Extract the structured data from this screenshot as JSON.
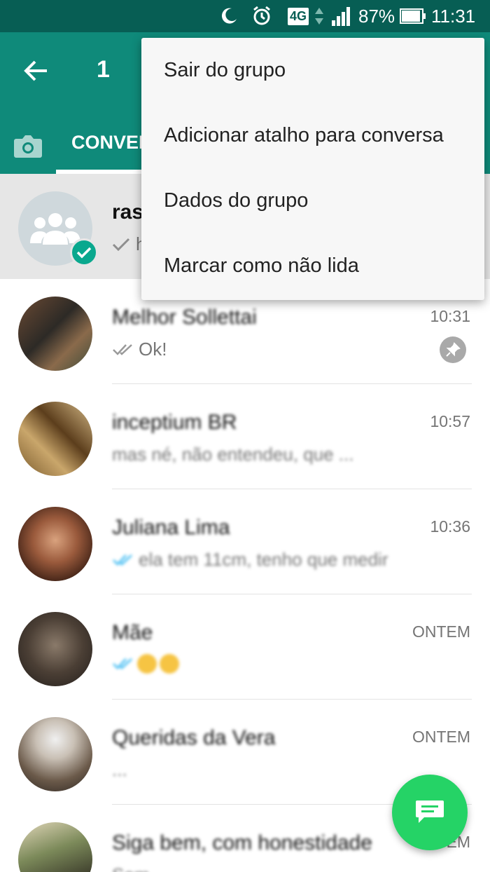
{
  "status_bar": {
    "battery": "87%",
    "time": "11:31",
    "network": "4G"
  },
  "app_bar": {
    "selected_count": "1"
  },
  "tabs": {
    "chats_label": "CONVERSAS"
  },
  "menu": {
    "items": [
      "Sair do grupo",
      "Adicionar atalho para conversa",
      "Dados do grupo",
      "Marcar como não lida"
    ]
  },
  "chats": [
    {
      "name": "ras",
      "preview": "h",
      "time": ""
    },
    {
      "name": "Melhor Sollettai",
      "preview": "Ok!",
      "time": "10:31"
    },
    {
      "name": "inceptium BR",
      "preview": "mas né, não entendeu, que ...",
      "time": "10:57"
    },
    {
      "name": "Juliana Lima",
      "preview": "ela tem 11cm, tenho que medir",
      "time": "10:36"
    },
    {
      "name": "Mãe",
      "preview": "",
      "time": "ONTEM"
    },
    {
      "name": "Queridas da Vera",
      "preview": "...",
      "time": "ONTEM"
    },
    {
      "name": "Siga bem, com honestidade",
      "preview": "Sem ...",
      "time": "ONTEM"
    }
  ],
  "colors": {
    "primary_dark": "#075e54",
    "primary": "#0f8a7a",
    "fab": "#25d366",
    "badge": "#0aa88e"
  }
}
